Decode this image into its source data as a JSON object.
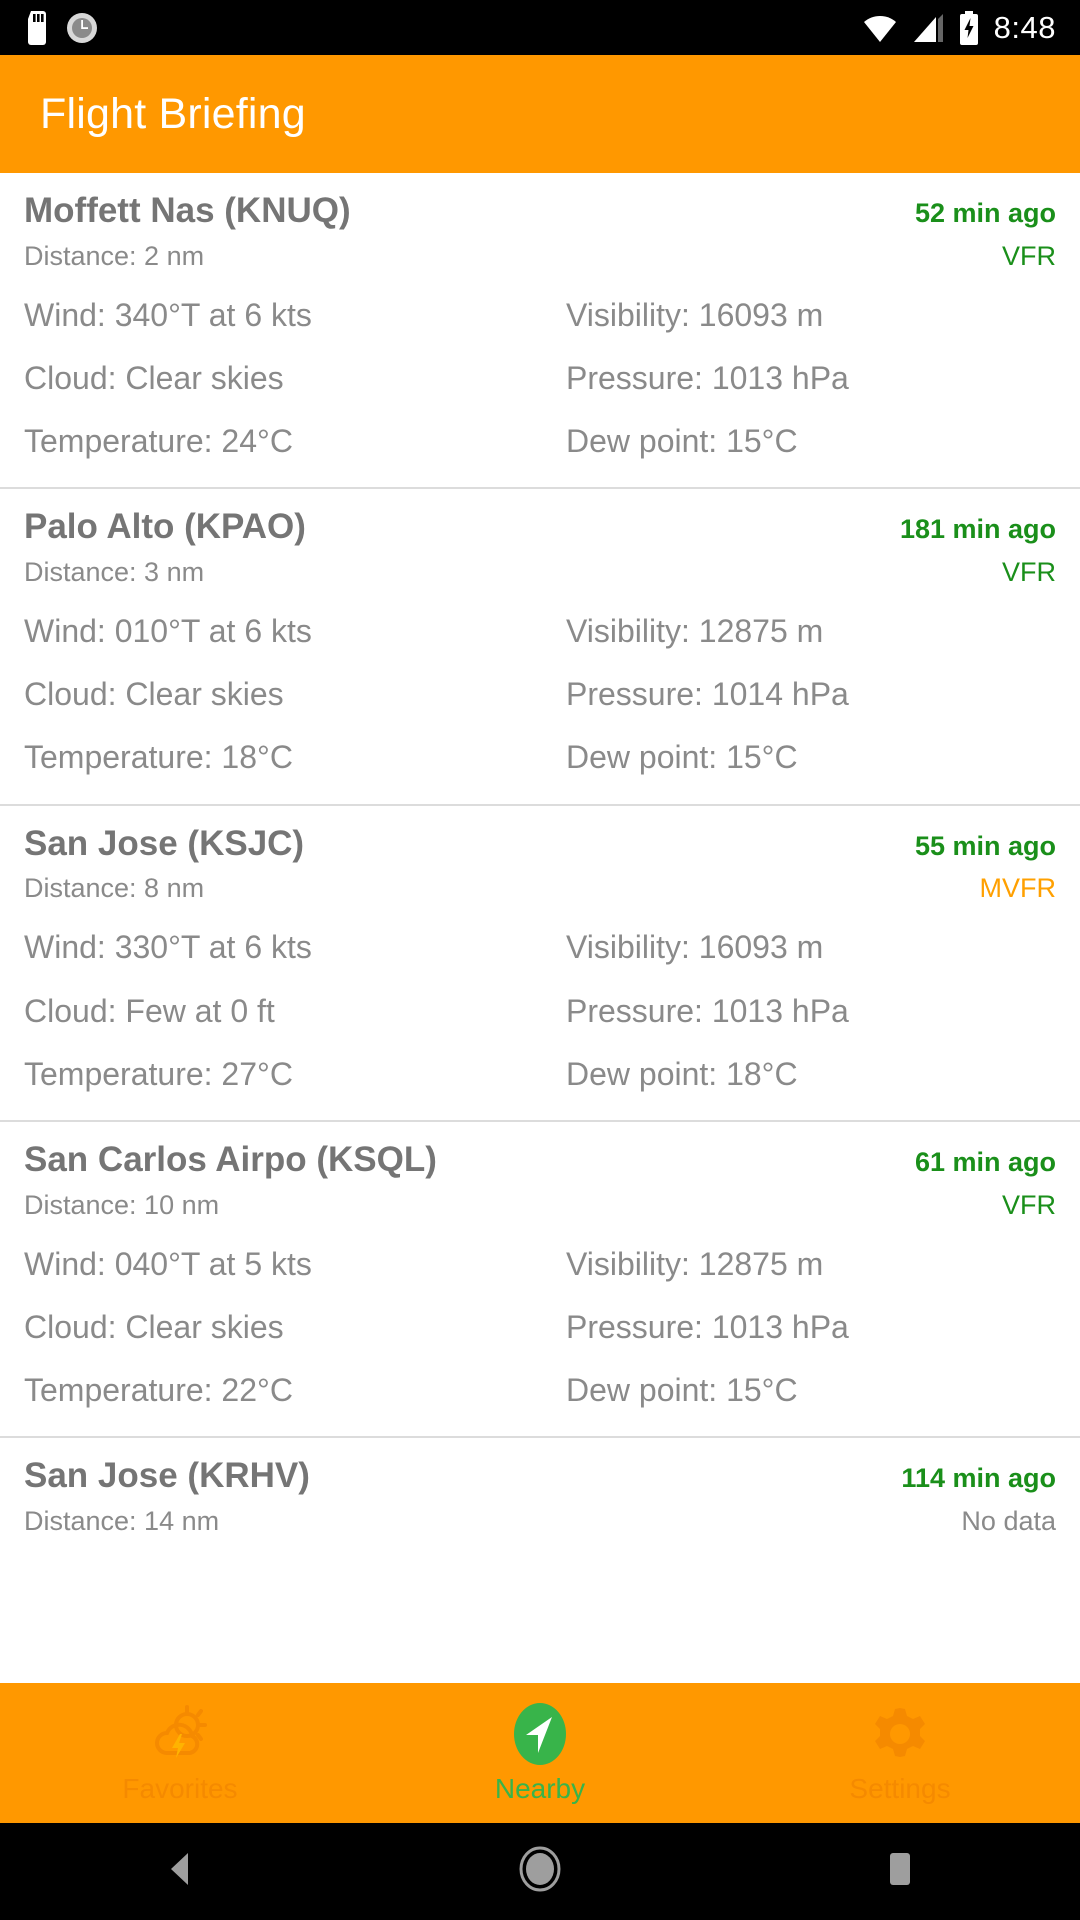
{
  "status_bar": {
    "time": "8:48",
    "icons": [
      "sd-card-icon",
      "clock-icon",
      "wifi-icon",
      "signal-icon",
      "battery-charging-icon"
    ]
  },
  "app_bar": {
    "title": "Flight Briefing"
  },
  "colors": {
    "accent": "#ff9800",
    "vfr": "#1a8f1a",
    "mvfr": "#ffa000",
    "nodata": "#8a8a8a",
    "active_tab": "#38b44a",
    "text": "#8a8a8a"
  },
  "labels": {
    "wind": "Wind:",
    "visibility": "Visibility:",
    "cloud": "Cloud:",
    "pressure": "Pressure:",
    "temperature": "Temperature:",
    "dew_point": "Dew point:",
    "distance": "Distance:"
  },
  "stations": [
    {
      "name": "Moffett Nas (KNUQ)",
      "age": "52 min ago",
      "distance": "Distance: 2 nm",
      "category": "VFR",
      "category_kind": "vfr",
      "wind": "Wind: 340°T at 6 kts",
      "visibility": "Visibility: 16093 m",
      "cloud": "Cloud: Clear skies",
      "pressure": "Pressure: 1013 hPa",
      "temperature": "Temperature: 24°C",
      "dew_point": "Dew point: 15°C"
    },
    {
      "name": "Palo Alto (KPAO)",
      "age": "181 min ago",
      "distance": "Distance: 3 nm",
      "category": "VFR",
      "category_kind": "vfr",
      "wind": "Wind: 010°T at 6 kts",
      "visibility": "Visibility: 12875 m",
      "cloud": "Cloud: Clear skies",
      "pressure": "Pressure: 1014 hPa",
      "temperature": "Temperature: 18°C",
      "dew_point": "Dew point: 15°C"
    },
    {
      "name": "San Jose (KSJC)",
      "age": "55 min ago",
      "distance": "Distance: 8 nm",
      "category": "MVFR",
      "category_kind": "mvfr",
      "wind": "Wind: 330°T at 6 kts",
      "visibility": "Visibility: 16093 m",
      "cloud": "Cloud: Few at 0 ft",
      "pressure": "Pressure: 1013 hPa",
      "temperature": "Temperature: 27°C",
      "dew_point": "Dew point: 18°C"
    },
    {
      "name": "San Carlos Airpo (KSQL)",
      "age": "61 min ago",
      "distance": "Distance: 10 nm",
      "category": "VFR",
      "category_kind": "vfr",
      "wind": "Wind: 040°T at 5 kts",
      "visibility": "Visibility: 12875 m",
      "cloud": "Cloud: Clear skies",
      "pressure": "Pressure: 1013 hPa",
      "temperature": "Temperature: 22°C",
      "dew_point": "Dew point: 15°C"
    },
    {
      "name": "San Jose (KRHV)",
      "age": "114 min ago",
      "distance": "Distance: 14 nm",
      "category": "No data",
      "category_kind": "none",
      "wind": "",
      "visibility": "",
      "cloud": "",
      "pressure": "",
      "temperature": "",
      "dew_point": ""
    }
  ],
  "bottom_nav": {
    "tabs": [
      {
        "label": "Favorites",
        "icon": "storm-weather-icon",
        "active": false
      },
      {
        "label": "Nearby",
        "icon": "navigation-arrow-icon",
        "active": true
      },
      {
        "label": "Settings",
        "icon": "gear-icon",
        "active": false
      }
    ]
  },
  "system_nav": {
    "back": "back-icon",
    "home": "home-icon",
    "recents": "recents-icon"
  }
}
